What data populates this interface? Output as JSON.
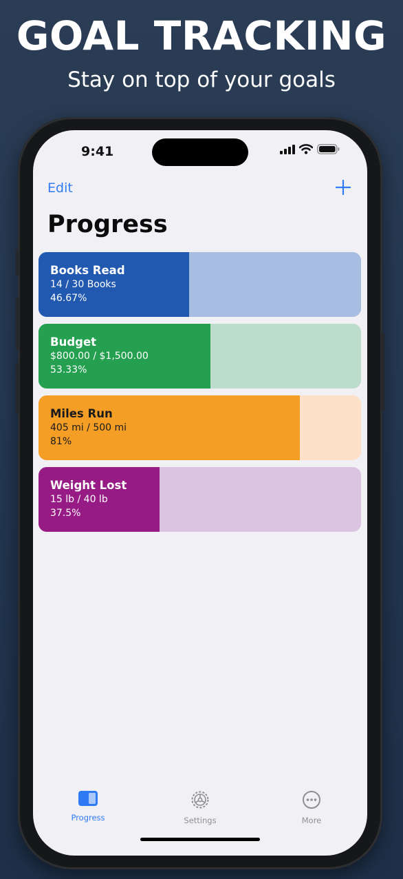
{
  "promo": {
    "headline": "GOAL TRACKING",
    "subline": "Stay on top of your goals"
  },
  "status_bar": {
    "time": "9:41",
    "icons": [
      "cellular-signal-icon",
      "wifi-icon",
      "battery-icon"
    ]
  },
  "nav": {
    "edit_label": "Edit",
    "add_icon": "plus-icon",
    "title": "Progress"
  },
  "goals": [
    {
      "name": "Books Read",
      "amount": "14 / 30 Books",
      "percent": "46.67%",
      "progress": 0.4667,
      "fill_color": "#2159b0",
      "track_color": "#a7bde2",
      "text_color": "#ffffff"
    },
    {
      "name": "Budget",
      "amount": "$800.00 / $1,500.00",
      "percent": "53.33%",
      "progress": 0.5333,
      "fill_color": "#25a051",
      "track_color": "#bcdccc",
      "text_color": "#ffffff"
    },
    {
      "name": "Miles Run",
      "amount": "405 mi / 500 mi",
      "percent": "81%",
      "progress": 0.81,
      "fill_color": "#f59e26",
      "track_color": "#fde1c8",
      "text_color": "#1a1a1a"
    },
    {
      "name": "Weight Lost",
      "amount": "15 lb / 40 lb",
      "percent": "37.5%",
      "progress": 0.375,
      "fill_color": "#971b85",
      "track_color": "#dbc4e1",
      "text_color": "#ffffff"
    }
  ],
  "tabs": [
    {
      "label": "Progress",
      "icon": "progress-icon",
      "active": true
    },
    {
      "label": "Settings",
      "icon": "gear-icon",
      "active": false
    },
    {
      "label": "More",
      "icon": "more-icon",
      "active": false
    }
  ],
  "colors": {
    "accent": "#2f7bf6",
    "inactive": "#8e8e93",
    "screen_bg": "#f1f0f5"
  }
}
